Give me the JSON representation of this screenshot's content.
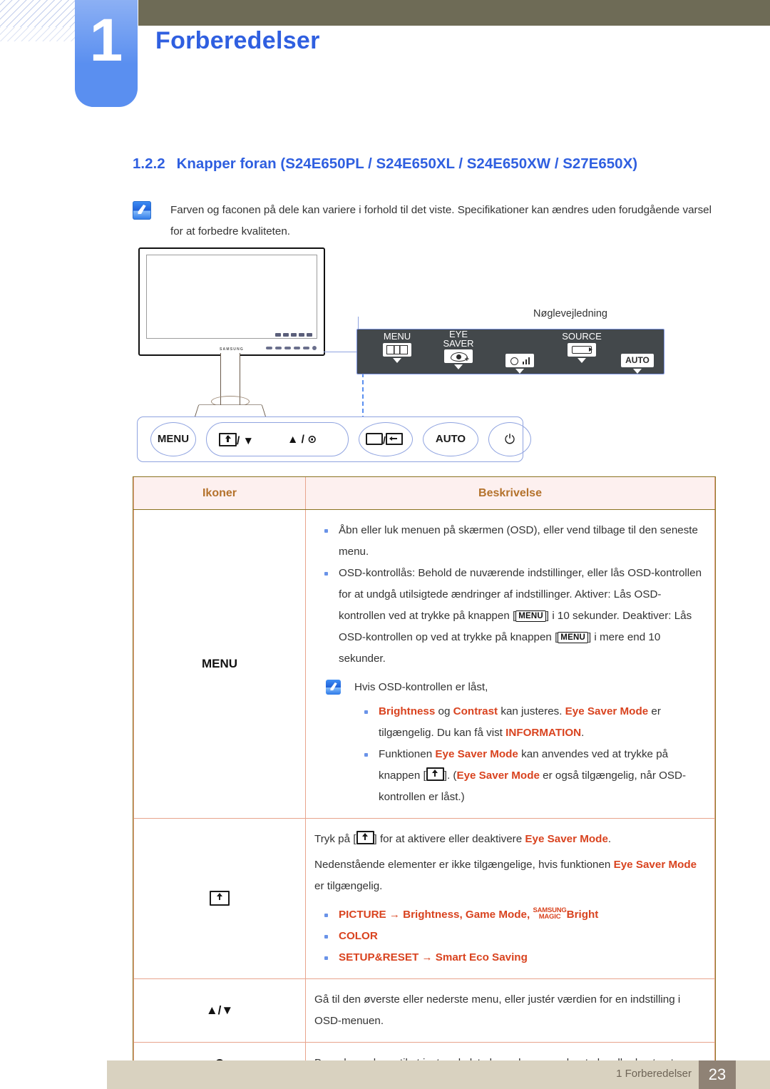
{
  "header": {
    "chapter_number": "1",
    "chapter_title": "Forberedelser"
  },
  "section": {
    "number": "1.2.2",
    "title": "Knapper foran (S24E650PL / S24E650XL / S24E650XW / S27E650X)"
  },
  "note": {
    "icon": "note-pencil-icon",
    "text": "Farven og faconen på dele kan variere i forhold til det viste. Specifikationer kan ændres uden forudgående varsel for at forbedre kvaliteten."
  },
  "illustration": {
    "monitor_brand": "SAMSUNG",
    "key_guide_title": "Nøglevejledning",
    "key_guide_buttons": [
      {
        "label": "MENU",
        "icon": "menu-bars-icon"
      },
      {
        "label": "EYE\nSAVER",
        "label_line1": "EYE",
        "label_line2": "SAVER",
        "icon": "eye-plus-icon"
      },
      {
        "label": "",
        "icon": "brightness-volume-icon"
      },
      {
        "label": "SOURCE",
        "icon": "source-loop-icon"
      },
      {
        "label": "",
        "icon": "auto-text-icon",
        "text": "AUTO"
      }
    ],
    "button_bar": [
      {
        "name": "menu-button",
        "text": "MENU"
      },
      {
        "name": "eyesaver-down-button",
        "text": "/ ▼",
        "icon": "screen-up-arrow-icon"
      },
      {
        "name": "up-adjust-button",
        "text": "▲ / ⊙"
      },
      {
        "name": "source-enter-button",
        "text": "/",
        "icon": "source-return-icon"
      },
      {
        "name": "auto-button",
        "text": "AUTO"
      },
      {
        "name": "power-button",
        "text": "⏻"
      }
    ]
  },
  "table": {
    "headers": {
      "col1": "Ikoner",
      "col2": "Beskrivelse"
    },
    "rows": [
      {
        "icon_label": "MENU",
        "icon_name": "menu-label-icon",
        "bullets": [
          "Åbn eller luk menuen på skærmen (OSD), eller vend tilbage til den seneste menu.",
          "OSD-kontrollås: Behold de nuværende indstillinger, eller lås OSD-kontrollen for at undgå utilsigtede ændringer af indstillinger. Aktiver: Lås OSD-kontrollen ved at trykke på knappen [MENU] i 10 sekunder. Deaktiver: Lås OSD-kontrollen op ved at trykke på knappen [MENU] i mere end 10 sekunder."
        ],
        "subnote_intro": "Hvis OSD-kontrollen er låst,",
        "subnote_bullets": [
          "Brightness og Contrast kan justeres. Eye Saver Mode er tilgængelig. Du kan få vist INFORMATION.",
          "Funktionen Eye Saver Mode kan anvendes ved at trykke på knappen [ ]. (Eye Saver Mode er også tilgængelig, når OSD-kontrollen er låst.)"
        ]
      },
      {
        "icon_label": "",
        "icon_name": "screen-up-arrow-icon",
        "line1": "Tryk på [ ] for at aktivere eller deaktivere Eye Saver Mode.",
        "line2": "Nedenstående elementer er ikke tilgængelige, hvis funktionen Eye Saver Mode er tilgængelig.",
        "menu_bullets": [
          {
            "head": "PICTURE",
            "arrow": "→",
            "items": "Brightness, Game Mode, ",
            "magic_top": "SAMSUNG",
            "magic_bottom": "MAGIC",
            "magic_suffix": "Bright"
          },
          {
            "head": "COLOR",
            "arrow": "",
            "items": ""
          },
          {
            "head": "SETUP&RESET",
            "arrow": "→",
            "items": "Smart Eco Saving"
          }
        ]
      },
      {
        "icon_label": "▲/▼",
        "icon_name": "up-down-arrows-icon",
        "text": "Gå til den øverste eller nederste menu, eller justér værdien for en indstilling i OSD-menuen."
      },
      {
        "icon_label": "⊙",
        "icon_name": "dot-circle-icon",
        "text": "Brug denne knap til at justere lydstyrken, skærmens lysstyrke eller kontrast."
      }
    ]
  },
  "footer": {
    "text": "1 Forberedelser",
    "page": "23"
  },
  "colors": {
    "accent_blue": "#2f5fe0",
    "red_term": "#d9431f",
    "table_header_bg": "#fdf0ef",
    "table_header_text": "#b4722c",
    "footer_bg": "#d9d2c0",
    "footer_page_bg": "#8f8275",
    "olive_bar": "#6e6b56"
  }
}
